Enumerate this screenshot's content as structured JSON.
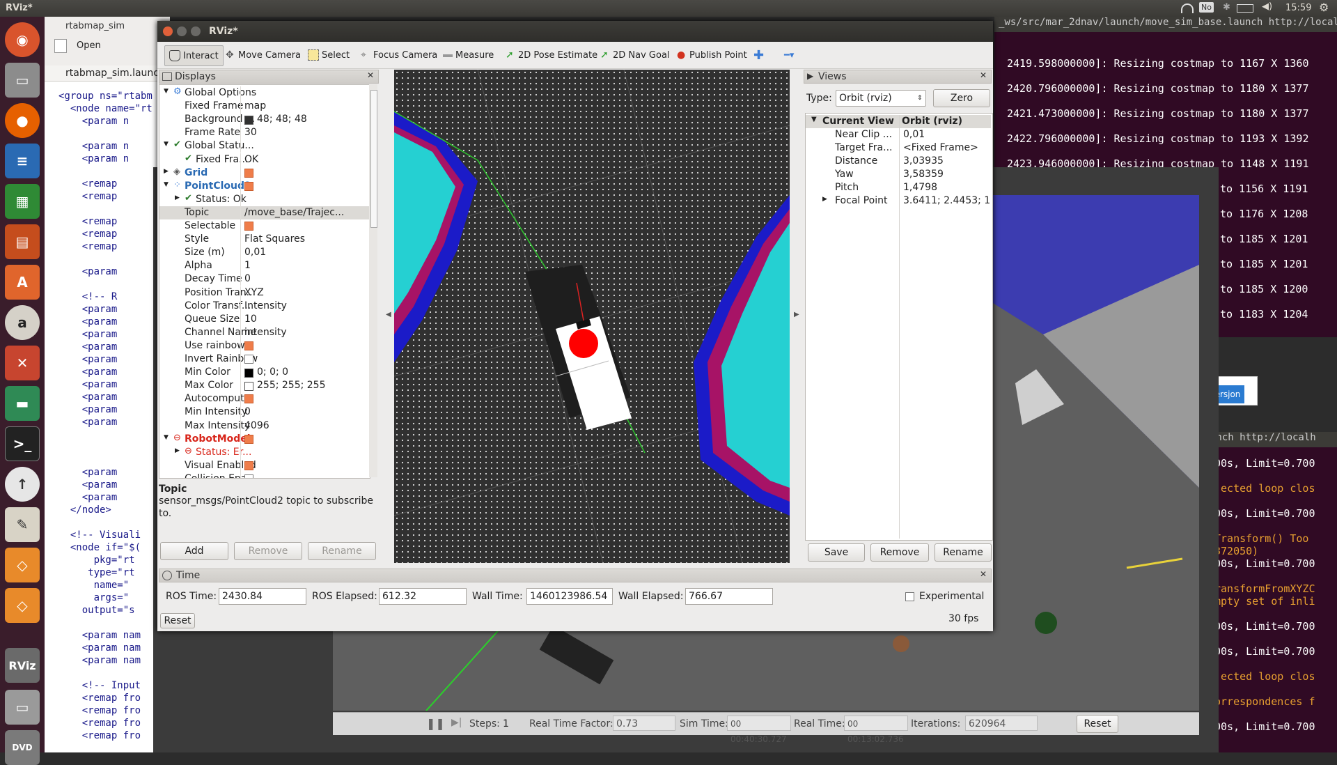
{
  "topbar": {
    "app": "RViz*",
    "clock": "15:59",
    "no_badge": "No"
  },
  "gedit": {
    "tab1": "rtabmap_sim",
    "tab2": "rtabmap_sim.launch",
    "open_label": "Open",
    "lines": [
      "<group ns=\"rtabm",
      "  <node name=\"rt",
      "    <param n",
      "",
      "    <param n",
      "    <param n",
      "",
      "    <remap",
      "    <remap",
      "",
      "    <remap",
      "    <remap",
      "    <remap",
      "",
      "    <param",
      "",
      "    <!-- R",
      "    <param",
      "    <param",
      "    <param",
      "    <param",
      "    <param",
      "    <param",
      "    <param",
      "    <param",
      "    <param",
      "    <param",
      "",
      "",
      "",
      "    <param",
      "    <param",
      "    <param",
      "  </node>",
      "",
      "  <!-- Visuali",
      "  <node if=\"$(",
      "      pkg=\"rt",
      "     type=\"rt",
      "      name=\"",
      "      args=\"",
      "    output=\"s",
      "",
      "    <param nam",
      "    <param nam",
      "    <param nam",
      "",
      "    <!-- Input",
      "    <remap fro",
      "    <remap fro",
      "    <remap fro",
      "    <remap fro"
    ]
  },
  "terminal": {
    "title": "_ws/src/mar_2dnav/launch/move_sim_base.launch http://localh",
    "lines": [
      "2419.598000000]: Resizing costmap to 1167 X 1360",
      "2420.796000000]: Resizing costmap to 1180 X 1377",
      "2421.473000000]: Resizing costmap to 1180 X 1377",
      "2422.796000000]: Resizing costmap to 1193 X 1392",
      "2423.946000000]: Resizing costmap to 1148 X 1191",
      "to 1156 X 1191",
      "to 1176 X 1208",
      "to 1185 X 1201",
      "to 1185 X 1201",
      "to 1185 X 1200",
      "to 1183 X 1204"
    ],
    "second_title": "unch http://localh",
    "second_lines": [
      "00s, Limit=0.700",
      "jected loop clos",
      "00s, Limit=0.700",
      "Transform() Too",
      "372050)",
      "00s, Limit=0.700",
      "ransformFromXYZC",
      "mpty set of inli",
      "00s, Limit=0.700",
      "00s, Limit=0.700",
      "jected loop clos",
      "orrespondences f",
      "00s, Limit=0.700"
    ],
    "popup_label": "ersjon"
  },
  "gazebo": {
    "steps_label": "Steps:",
    "steps_value": "1",
    "rtf_label": "Real Time Factor:",
    "rtf_value": "0.73",
    "sim_label": "Sim Time:",
    "sim_value": "00 00:40:30.727",
    "real_label": "Real Time:",
    "real_value": "00 00:13:02.736",
    "iter_label": "Iterations:",
    "iter_value": "620964",
    "reset_label": "Reset"
  },
  "rviz": {
    "title": "RViz*",
    "toolbar": [
      "Interact",
      "Move Camera",
      "Select",
      "Focus Camera",
      "Measure",
      "2D Pose Estimate",
      "2D Nav Goal",
      "Publish Point"
    ],
    "displays": {
      "title": "Displays",
      "rows": [
        {
          "name": "Global Options",
          "value": "",
          "indent": 1,
          "expander": "▼",
          "icon": "gear",
          "state": "normal"
        },
        {
          "name": "Fixed Frame",
          "value": "map",
          "indent": 2,
          "expander": "",
          "icon": "",
          "state": "normal"
        },
        {
          "name": "Background ...",
          "value": "48; 48; 48",
          "indent": 2,
          "expander": "",
          "icon": "",
          "state": "normal",
          "swatch": "#303030"
        },
        {
          "name": "Frame Rate",
          "value": "30",
          "indent": 2,
          "expander": "",
          "icon": "",
          "state": "normal"
        },
        {
          "name": "Global Statu...",
          "value": "",
          "indent": 1,
          "expander": "▼",
          "icon": "check",
          "state": "normal"
        },
        {
          "name": "Fixed Fra...",
          "value": "OK",
          "indent": 2,
          "expander": "",
          "icon": "check",
          "state": "normal"
        },
        {
          "name": "Grid",
          "value": "",
          "indent": 1,
          "expander": "▶",
          "icon": "grid",
          "state": "blue",
          "cb": "on"
        },
        {
          "name": "PointCloud2",
          "value": "",
          "indent": 1,
          "expander": "▼",
          "icon": "cloud",
          "state": "blue",
          "cb": "on"
        },
        {
          "name": "Status: Ok",
          "value": "",
          "indent": 2,
          "expander": "▶",
          "icon": "check",
          "state": "normal"
        },
        {
          "name": "Topic",
          "value": "/move_base/Trajec...",
          "indent": 2,
          "expander": "",
          "icon": "",
          "state": "selected"
        },
        {
          "name": "Selectable",
          "value": "",
          "indent": 2,
          "expander": "",
          "icon": "",
          "state": "normal",
          "cb": "on"
        },
        {
          "name": "Style",
          "value": "Flat Squares",
          "indent": 2,
          "expander": "",
          "icon": "",
          "state": "normal"
        },
        {
          "name": "Size (m)",
          "value": "0,01",
          "indent": 2,
          "expander": "",
          "icon": "",
          "state": "normal"
        },
        {
          "name": "Alpha",
          "value": "1",
          "indent": 2,
          "expander": "",
          "icon": "",
          "state": "normal"
        },
        {
          "name": "Decay Time",
          "value": "0",
          "indent": 2,
          "expander": "",
          "icon": "",
          "state": "normal"
        },
        {
          "name": "Position Tran...",
          "value": "XYZ",
          "indent": 2,
          "expander": "",
          "icon": "",
          "state": "normal"
        },
        {
          "name": "Color Transf...",
          "value": "Intensity",
          "indent": 2,
          "expander": "",
          "icon": "",
          "state": "normal"
        },
        {
          "name": "Queue Size",
          "value": "10",
          "indent": 2,
          "expander": "",
          "icon": "",
          "state": "normal"
        },
        {
          "name": "Channel Name",
          "value": "intensity",
          "indent": 2,
          "expander": "",
          "icon": "",
          "state": "normal"
        },
        {
          "name": "Use rainbow",
          "value": "",
          "indent": 2,
          "expander": "",
          "icon": "",
          "state": "normal",
          "cb": "on"
        },
        {
          "name": "Invert Rainbow",
          "value": "",
          "indent": 2,
          "expander": "",
          "icon": "",
          "state": "normal",
          "cb": "off"
        },
        {
          "name": "Min Color",
          "value": "0; 0; 0",
          "indent": 2,
          "expander": "",
          "icon": "",
          "state": "normal",
          "swatch": "#000000"
        },
        {
          "name": "Max Color",
          "value": "255; 255; 255",
          "indent": 2,
          "expander": "",
          "icon": "",
          "state": "normal",
          "swatch": "#ffffff"
        },
        {
          "name": "Autocomput...",
          "value": "",
          "indent": 2,
          "expander": "",
          "icon": "",
          "state": "normal",
          "cb": "on"
        },
        {
          "name": "Min Intensity",
          "value": "0",
          "indent": 2,
          "expander": "",
          "icon": "",
          "state": "normal"
        },
        {
          "name": "Max Intensity",
          "value": "4096",
          "indent": 2,
          "expander": "",
          "icon": "",
          "state": "normal"
        },
        {
          "name": "RobotModel",
          "value": "",
          "indent": 1,
          "expander": "▼",
          "icon": "err",
          "state": "red",
          "cb": "on"
        },
        {
          "name": "Status: Er...",
          "value": "",
          "indent": 2,
          "expander": "▶",
          "icon": "err",
          "state": "red"
        },
        {
          "name": "Visual Enabled",
          "value": "",
          "indent": 2,
          "expander": "",
          "icon": "",
          "state": "normal",
          "cb": "on"
        },
        {
          "name": "Collision Ena...",
          "value": "",
          "indent": 2,
          "expander": "",
          "icon": "",
          "state": "normal",
          "cb": "off"
        }
      ],
      "desc_title": "Topic",
      "desc_text": "sensor_msgs/PointCloud2 topic to subscribe to.",
      "add": "Add",
      "remove": "Remove",
      "rename": "Rename"
    },
    "views": {
      "title": "Views",
      "type_label": "Type:",
      "type_value": "Orbit (rviz)",
      "zero": "Zero",
      "col1": "Current View",
      "col2": "Orbit (rviz)",
      "rows": [
        {
          "name": "Near Clip ...",
          "value": "0,01",
          "expander": ""
        },
        {
          "name": "Target Fra...",
          "value": "<Fixed Frame>",
          "expander": ""
        },
        {
          "name": "Distance",
          "value": "3,03935",
          "expander": ""
        },
        {
          "name": "Yaw",
          "value": "3,58359",
          "expander": ""
        },
        {
          "name": "Pitch",
          "value": "1,4798",
          "expander": ""
        },
        {
          "name": "Focal Point",
          "value": "3.6411; 2.4453; 1...",
          "expander": "▶"
        }
      ],
      "save": "Save",
      "remove": "Remove",
      "rename": "Rename"
    },
    "time": {
      "title": "Time",
      "ros_time_label": "ROS Time:",
      "ros_time": "2430.84",
      "ros_elapsed_label": "ROS Elapsed:",
      "ros_elapsed": "612.32",
      "wall_time_label": "Wall Time:",
      "wall_time": "1460123986.54",
      "wall_elapsed_label": "Wall Elapsed:",
      "wall_elapsed": "766.67",
      "experimental": "Experimental",
      "reset": "Reset",
      "fps": "30 fps"
    }
  }
}
